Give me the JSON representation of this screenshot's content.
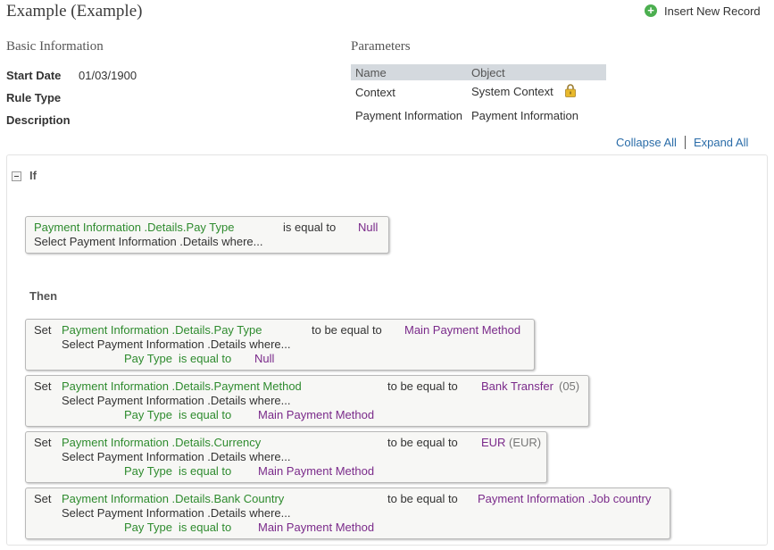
{
  "header": {
    "title": "Example (Example)",
    "insert_label": "Insert New Record"
  },
  "basic_info": {
    "title": "Basic Information",
    "start_date_label": "Start Date",
    "start_date_value": "01/03/1900",
    "rule_type_label": "Rule Type",
    "description_label": "Description"
  },
  "parameters": {
    "title": "Parameters",
    "col_name": "Name",
    "col_object": "Object",
    "rows": [
      {
        "name": "Context",
        "object": "System Context",
        "locked": true
      },
      {
        "name": "Payment Information",
        "object": "Payment Information",
        "locked": false
      }
    ]
  },
  "toolbar": {
    "collapse_all": "Collapse All",
    "expand_all": "Expand All"
  },
  "rule": {
    "if_label": "If",
    "then_label": "Then",
    "condition": {
      "field": "Payment Information .Details.Pay Type",
      "operator": "is equal to",
      "value": "Null",
      "select": "Select Payment Information .Details where..."
    },
    "actions": [
      {
        "set": "Set",
        "field": "Payment Information .Details.Pay Type",
        "op": "to be equal to",
        "value": "Main Payment Method",
        "value_suffix": "",
        "select": "Select Payment Information .Details where...",
        "where_field": "Pay Type",
        "where_op": "is equal to",
        "where_value": "Null"
      },
      {
        "set": "Set",
        "field": "Payment Information .Details.Payment Method",
        "op": "to be equal to",
        "value": "Bank Transfer",
        "value_suffix": "(05)",
        "select": "Select Payment Information .Details where...",
        "where_field": "Pay Type",
        "where_op": "is equal to",
        "where_value": "Main Payment Method"
      },
      {
        "set": "Set",
        "field": "Payment Information .Details.Currency",
        "op": "to be equal to",
        "value": "EUR",
        "value_suffix": "(EUR)",
        "select": "Select Payment Information .Details where...",
        "where_field": "Pay Type",
        "where_op": "is equal to",
        "where_value": "Main Payment Method"
      },
      {
        "set": "Set",
        "field": "Payment Information .Details.Bank Country",
        "op": "to be equal to",
        "value": "Payment Information .Job country",
        "value_suffix": "",
        "select": "Select Payment Information .Details where...",
        "where_field": "Pay Type",
        "where_op": "is equal to",
        "where_value": "Main Payment Method"
      }
    ]
  },
  "colors": {
    "field_green": "#2e8b2e",
    "value_purple": "#7a2a8a",
    "link_blue": "#2a6ca8",
    "table_header_bg": "#d4d9de"
  }
}
